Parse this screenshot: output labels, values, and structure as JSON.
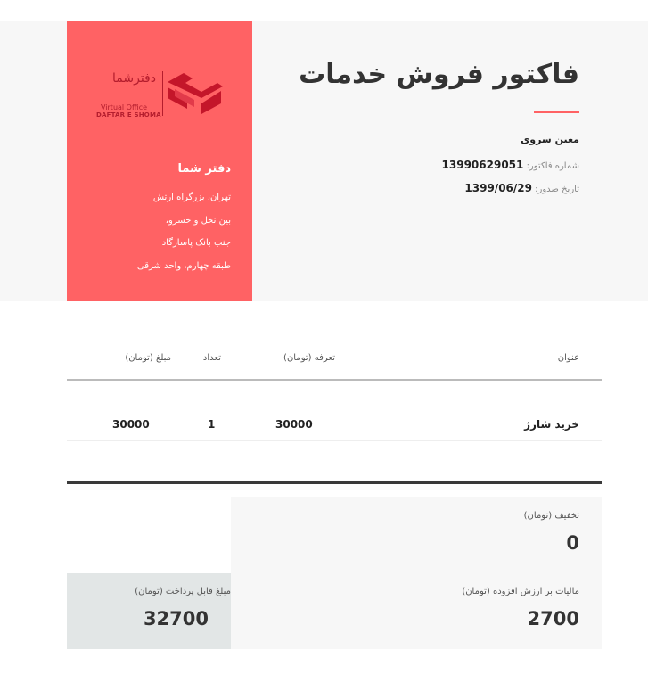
{
  "company": {
    "logo_fa": "دفترشما",
    "logo_en_line1": "Virtual Office",
    "logo_en_line2": "DAFTAR E SHOMA",
    "name": "دفتر شما",
    "address_lines": [
      "تهران، بزرگراه ارتش",
      "بین نخل و خسرو،",
      "جنب بانک پاسارگاد",
      "طبقه چهارم، واحد شرقی"
    ],
    "brand_color": "#ff6264",
    "logo_color": "#b41d2d"
  },
  "invoice": {
    "title": "فاکتور فروش خدمات",
    "customer": "معین سروی",
    "number_label": "شماره فاکتور:",
    "number": "13990629051",
    "date_label": "تاریخ صدور:",
    "date": "1399/06/29"
  },
  "table": {
    "headers": {
      "title": "عنوان",
      "rate": "تعرفه (تومان)",
      "qty": "تعداد",
      "amount": "مبلغ (تومان)"
    },
    "rows": [
      {
        "title": "خرید شارژ",
        "rate": "30000",
        "qty": "1",
        "amount": "30000"
      }
    ]
  },
  "summary": {
    "discount_label": "تخفیف (تومان)",
    "discount": "0",
    "vat_label": "مالیات بر ارزش افزوده (تومان)",
    "vat": "2700",
    "payable_label": "مبلغ قابل پرداخت (تومان)",
    "payable": "32700"
  }
}
